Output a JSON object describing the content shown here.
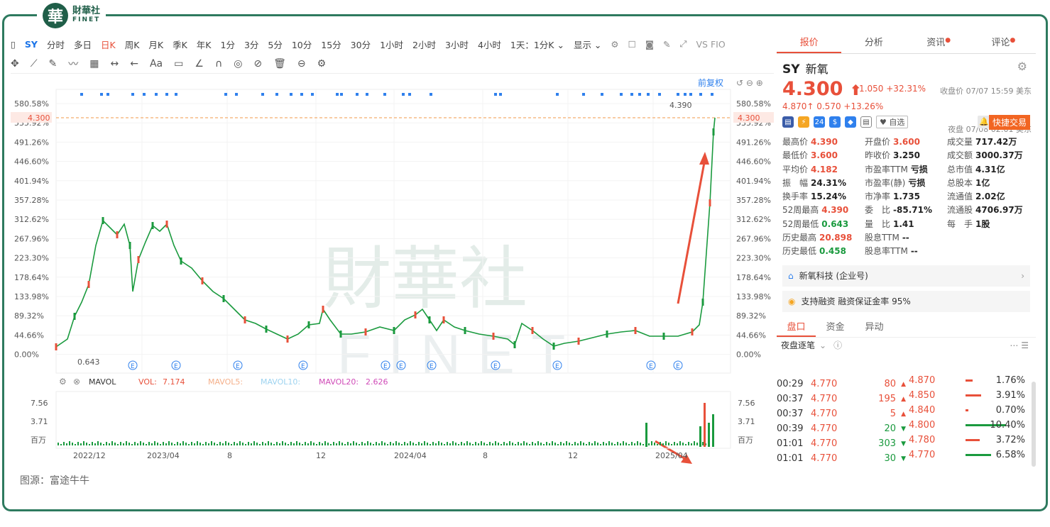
{
  "brand": {
    "seal_char": "華",
    "name_cn": "財華社",
    "name_en": "FINET",
    "watermark_cn": "財華社",
    "watermark_en": "FINET"
  },
  "source": "图源：富途牛牛",
  "toolbar": {
    "symbol": "SY",
    "periods": [
      "分时",
      "多日",
      "日K",
      "周K",
      "月K",
      "季K",
      "年K",
      "1分",
      "3分",
      "5分",
      "10分",
      "15分",
      "30分",
      "1小时",
      "2小时",
      "3小时",
      "4小时"
    ],
    "active_period": "日K",
    "day_setting": "1天：1分K",
    "display": "显示",
    "right_labels": "VS FIO",
    "draw_label": "Aa",
    "restore": "前复权"
  },
  "chart": {
    "y_ticks": [
      "580.58%",
      "535.92%",
      "491.26%",
      "446.60%",
      "401.94%",
      "357.28%",
      "312.62%",
      "267.96%",
      "223.30%",
      "178.64%",
      "133.98%",
      "89.32%",
      "44.66%",
      "0.00%"
    ],
    "current_price_label": "4.300",
    "high_label": "4.390",
    "low_label": "0.643",
    "x_ticks": [
      "2022/12",
      "2023/04",
      "8",
      "12",
      "2024/04",
      "8",
      "12",
      "2025/04"
    ],
    "vol_ticks": [
      "7.56",
      "3.71",
      "百万"
    ],
    "indicator": {
      "name": "MAVOL",
      "vol": "VOL:",
      "vol_val": "7.174",
      "mavol5": "MAVOL5:",
      "mavol10": "MAVOL10:",
      "mavol20": "MAVOL20:",
      "mavol20_val": "2.626"
    },
    "colors": {
      "up": "#e8503a",
      "down": "#1a9a3e",
      "accent": "#e8503a"
    }
  },
  "quote": {
    "tabs": [
      "报价",
      "分析",
      "资讯",
      "评论"
    ],
    "symbol": "SY",
    "name": "新氧",
    "price": "4.300",
    "change": "+1.050",
    "change_pct": "+32.31%",
    "close_meta": "收盘价 07/07 15:59 美东",
    "night_price": "4.870",
    "night_change": "0.570",
    "night_pct": "+13.26%",
    "night_meta": "夜盘 07/08 02:01 美东",
    "fav": "自选",
    "trade": "快捷交易",
    "stats": [
      [
        "最高价",
        "4.390",
        "r"
      ],
      [
        "开盘价",
        "3.600",
        "r"
      ],
      [
        "成交量",
        "717.42万",
        "k"
      ],
      [
        "最低价",
        "3.600",
        "r"
      ],
      [
        "昨收价",
        "3.250",
        "k"
      ],
      [
        "成交额",
        "3000.37万",
        "k"
      ],
      [
        "平均价",
        "4.182",
        "r"
      ],
      [
        "市盈率TTM",
        "亏损",
        "k"
      ],
      [
        "总市值",
        "4.31亿",
        "k"
      ],
      [
        "振　幅",
        "24.31%",
        "k"
      ],
      [
        "市盈率(静)",
        "亏损",
        "k"
      ],
      [
        "总股本",
        "1亿",
        "k"
      ],
      [
        "换手率",
        "15.24%",
        "k"
      ],
      [
        "市净率",
        "1.735",
        "k"
      ],
      [
        "流通值",
        "2.02亿",
        "k"
      ],
      [
        "52周最高",
        "4.390",
        "r"
      ],
      [
        "委　比",
        "-85.71%",
        "k"
      ],
      [
        "流通股",
        "4706.97万",
        "k"
      ],
      [
        "52周最低",
        "0.643",
        "g"
      ],
      [
        "量　比",
        "1.41",
        "k"
      ],
      [
        "每　手",
        "1股",
        "k"
      ],
      [
        "历史最高",
        "20.898",
        "r"
      ],
      [
        "股息TTM",
        "--",
        "k"
      ],
      [
        "",
        "",
        " "
      ],
      [
        "历史最低",
        "0.458",
        "g"
      ],
      [
        "股息率TTM",
        "--",
        "k"
      ],
      [
        "",
        "",
        " "
      ]
    ],
    "company": "新氧科技 (企业号)",
    "margin": "支持融资 融资保证金率 95%",
    "market_tabs": [
      "盘口",
      "资金",
      "异动"
    ],
    "night_trades_label": "夜盘逐笔",
    "trades": [
      [
        "00:29",
        "4.770",
        "80"
      ],
      [
        "00:37",
        "4.770",
        "195"
      ],
      [
        "00:37",
        "4.770",
        "5"
      ],
      [
        "00:39",
        "4.770",
        "20"
      ],
      [
        "01:01",
        "4.770",
        "303"
      ],
      [
        "01:01",
        "4.770",
        "30"
      ]
    ],
    "book": [
      [
        "4.870",
        "1.76%"
      ],
      [
        "4.850",
        "3.91%"
      ],
      [
        "4.840",
        "0.70%"
      ],
      [
        "4.800",
        "10.40%"
      ],
      [
        "4.780",
        "3.72%"
      ],
      [
        "4.770",
        "6.58%"
      ]
    ]
  }
}
